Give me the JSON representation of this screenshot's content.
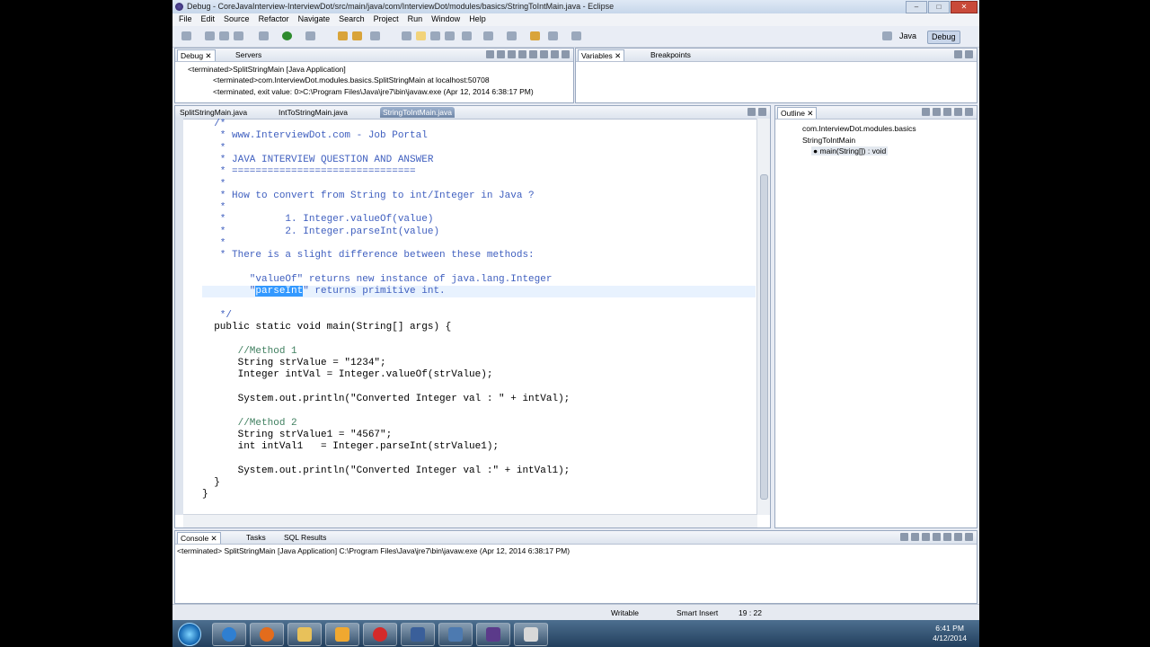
{
  "window": {
    "title": "Debug - CoreJavaInterview-InterviewDot/src/main/java/com/InterviewDot/modules/basics/StringToIntMain.java - Eclipse",
    "minimize": "–",
    "maximize": "□",
    "close": "✕"
  },
  "menu": [
    "File",
    "Edit",
    "Source",
    "Refactor",
    "Navigate",
    "Search",
    "Project",
    "Run",
    "Window",
    "Help"
  ],
  "perspectives": {
    "java": "Java",
    "debug": "Debug"
  },
  "debug_view": {
    "tabs": [
      "Debug",
      "Servers"
    ],
    "rows": [
      "<terminated>SplitStringMain [Java Application]",
      "<terminated>com.InterviewDot.modules.basics.SplitStringMain at localhost:50708",
      "<terminated, exit value: 0>C:\\Program Files\\Java\\jre7\\bin\\javaw.exe (Apr 12, 2014 6:38:17 PM)"
    ]
  },
  "variables_view": {
    "tabs": [
      "Variables",
      "Breakpoints"
    ]
  },
  "editor": {
    "tabs": [
      "SplitStringMain.java",
      "IntToStringMain.java",
      "StringToIntMain.java"
    ],
    "lines": [
      {
        "t": "  /*",
        "c": "c-com"
      },
      {
        "t": "   * www.InterviewDot.com - Job Portal",
        "c": "c-com"
      },
      {
        "t": "   *",
        "c": "c-com"
      },
      {
        "t": "   * JAVA INTERVIEW QUESTION AND ANSWER",
        "c": "c-com"
      },
      {
        "t": "   * ===============================",
        "c": "c-com"
      },
      {
        "t": "   *",
        "c": "c-com"
      },
      {
        "t": "   * How to convert from String to int/Integer in Java ?",
        "c": "c-com"
      },
      {
        "t": "   *",
        "c": "c-com"
      },
      {
        "t": "   *          1. Integer.valueOf(value)",
        "c": "c-com"
      },
      {
        "t": "   *          2. Integer.parseInt(value)",
        "c": "c-com"
      },
      {
        "t": "   *",
        "c": "c-com"
      },
      {
        "t": "   * There is a slight difference between these methods:",
        "c": "c-com"
      },
      {
        "t": "",
        "c": ""
      },
      {
        "t": "        \"valueOf\" returns new instance of java.lang.Integer",
        "c": "c-com"
      },
      {
        "t": "        \"parseInt\" returns primitive int.",
        "c": "c-com"
      },
      {
        "t": "",
        "c": ""
      },
      {
        "t": "   */",
        "c": "c-com"
      },
      {
        "t": "  public static void main(String[] args) {",
        "c": ""
      },
      {
        "t": "",
        "c": ""
      },
      {
        "t": "      //Method 1",
        "c": "c-grey"
      },
      {
        "t": "      String strValue = \"1234\";",
        "c": ""
      },
      {
        "t": "      Integer intVal = Integer.valueOf(strValue);",
        "c": ""
      },
      {
        "t": "",
        "c": ""
      },
      {
        "t": "      System.out.println(\"Converted Integer val : \" + intVal);",
        "c": ""
      },
      {
        "t": "",
        "c": ""
      },
      {
        "t": "      //Method 2",
        "c": "c-grey"
      },
      {
        "t": "      String strValue1 = \"4567\";",
        "c": ""
      },
      {
        "t": "      int intVal1   = Integer.parseInt(strValue1);",
        "c": ""
      },
      {
        "t": "",
        "c": ""
      },
      {
        "t": "      System.out.println(\"Converted Integer val :\" + intVal1);",
        "c": ""
      },
      {
        "t": "  }",
        "c": ""
      },
      {
        "t": "}",
        "c": ""
      }
    ],
    "selected_word": "parseInt"
  },
  "outline": {
    "tab": "Outline",
    "package": "com.InterviewDot.modules.basics",
    "class": "StringToIntMain",
    "method": "main(String[]) : void"
  },
  "console": {
    "tabs": [
      "Console",
      "Tasks",
      "SQL Results"
    ],
    "line": "<terminated> SplitStringMain [Java Application] C:\\Program Files\\Java\\jre7\\bin\\javaw.exe (Apr 12, 2014 6:38:17 PM)"
  },
  "status": {
    "writable": "Writable",
    "insert": "Smart Insert",
    "position": "19 : 22"
  },
  "taskbar": {
    "time": "6:41 PM",
    "date": "4/12/2014"
  }
}
